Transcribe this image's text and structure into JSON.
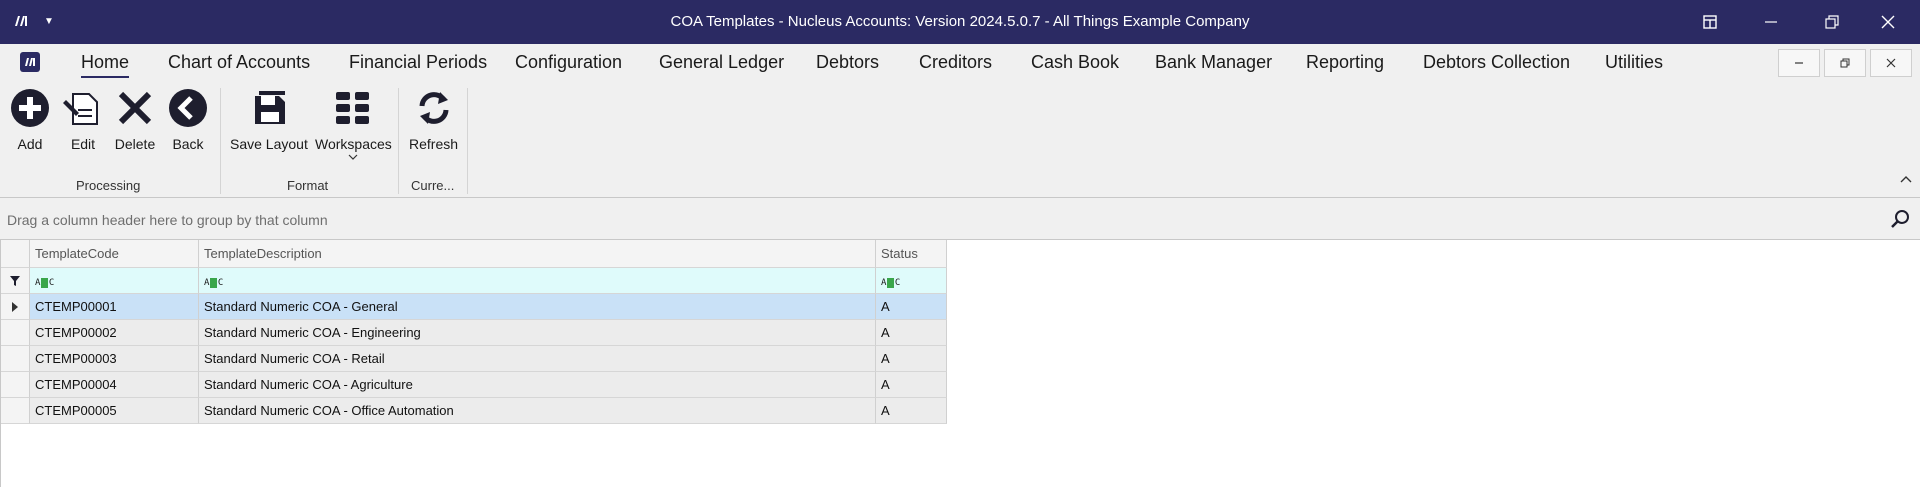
{
  "window": {
    "title": "COA Templates - Nucleus Accounts: Version 2024.5.0.7 - All Things Example Company"
  },
  "ribbon": {
    "tabs": [
      {
        "label": "Home"
      },
      {
        "label": "Chart of Accounts"
      },
      {
        "label": "Financial Periods"
      },
      {
        "label": "Configuration"
      },
      {
        "label": "General Ledger"
      },
      {
        "label": "Debtors"
      },
      {
        "label": "Creditors"
      },
      {
        "label": "Cash Book"
      },
      {
        "label": "Bank Manager"
      },
      {
        "label": "Reporting"
      },
      {
        "label": "Debtors Collection"
      },
      {
        "label": "Utilities"
      }
    ],
    "buttons": {
      "add": "Add",
      "edit": "Edit",
      "delete": "Delete",
      "back": "Back",
      "save_layout": "Save Layout",
      "workspaces": "Workspaces",
      "refresh": "Refresh"
    },
    "groups": {
      "processing": "Processing",
      "format": "Format",
      "currency": "Curre..."
    }
  },
  "grid": {
    "group_hint": "Drag a column header here to group by that column",
    "columns": [
      "TemplateCode",
      "TemplateDescription",
      "Status"
    ],
    "rows": [
      {
        "code": "CTEMP00001",
        "description": "Standard Numeric COA - General",
        "status": "A"
      },
      {
        "code": "CTEMP00002",
        "description": "Standard Numeric COA - Engineering",
        "status": "A"
      },
      {
        "code": "CTEMP00003",
        "description": "Standard Numeric COA - Retail",
        "status": "A"
      },
      {
        "code": "CTEMP00004",
        "description": "Standard Numeric COA - Agriculture",
        "status": "A"
      },
      {
        "code": "CTEMP00005",
        "description": "Standard Numeric COA - Office Automation",
        "status": "A"
      }
    ],
    "selected_row": 0
  },
  "colors": {
    "titlebar": "#2b2a63",
    "selected_row": "#c9e1f7",
    "row": "#ececec",
    "filter_row": "#dffbfb"
  },
  "icons": [
    "app-icon",
    "add-icon",
    "edit-icon",
    "delete-icon",
    "back-icon",
    "save-layout-icon",
    "workspaces-icon",
    "refresh-icon",
    "search-icon",
    "filter-icon"
  ]
}
